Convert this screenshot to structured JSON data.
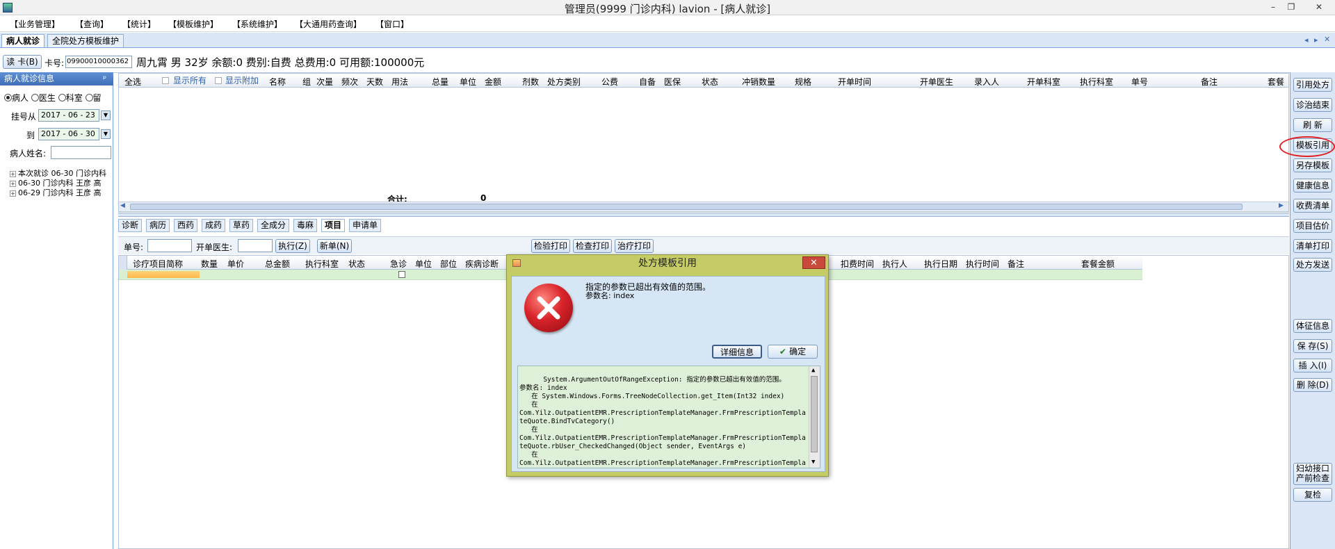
{
  "window": {
    "title": "管理员(9999 门诊内科) lavion - [病人就诊]",
    "controls": [
      "–",
      "❐",
      "✕"
    ]
  },
  "menu": [
    "【业务管理】",
    "【查询】",
    "【统计】",
    "【模板维护】",
    "【系统维护】",
    "【大通用药查询】",
    "【窗口】"
  ],
  "tabs": [
    "病人就诊",
    "全院处方模板维护"
  ],
  "tab_nav": [
    "◂",
    "▸",
    "✕"
  ],
  "patient_bar": {
    "read_card": "读 卡(B)",
    "card_label": "卡号:",
    "card_value": "09900010000362",
    "info": "周九霄  男  32岁  余额:0  费别:自费  总费用:0  可用额:100000元"
  },
  "left_panel": {
    "header": "病人就诊信息",
    "pin": "ᵖ",
    "radios": [
      "病人",
      "医生",
      "科室",
      "留"
    ],
    "date_from_label": "挂号从",
    "date_from": "2017 - 06 - 23",
    "date_to_label": "到",
    "date_to": "2017 - 06 - 30",
    "name_label": "病人姓名:",
    "tree": [
      "本次就诊  06-30  门诊内科",
      "06-30  门诊内科  王彦  高",
      "06-29  门诊内科  王彦  高"
    ]
  },
  "top_grid": {
    "columns": [
      "全选",
      "显示所有",
      "显示附加",
      "名称",
      "组",
      "次量",
      "频次",
      "天数",
      "用法",
      "总量",
      "单位",
      "金额",
      "剂数",
      "处方类别",
      "公费",
      "自备",
      "医保",
      "状态",
      "冲销数量",
      "规格",
      "开单时间",
      "开单医生",
      "录入人",
      "开单科室",
      "执行科室",
      "单号",
      "备注",
      "套餐"
    ],
    "total_label": "合计:",
    "total_value": "0"
  },
  "sub_tabs": [
    "诊断",
    "病历",
    "西药",
    "成药",
    "草药",
    "全成分",
    "毒麻",
    "项目",
    "申请单"
  ],
  "item_toolbar": {
    "order_label": "单号:",
    "doctor_label": "开单医生:",
    "execute": "执行(Z)",
    "new": "新单(N)",
    "lab_print": "检验打印",
    "exam_print": "检查打印",
    "treat_print": "治疗打印"
  },
  "bottom_grid": {
    "columns": [
      "诊疗项目简称",
      "数量",
      "单价",
      "总金额",
      "执行科室",
      "状态",
      "急诊",
      "单位",
      "部位",
      "疾病诊断",
      "扣费时间",
      "执行人",
      "执行日期",
      "执行时间",
      "备注",
      "套餐金额"
    ]
  },
  "right_buttons": [
    "引用处方",
    "诊治结束",
    "刷 新",
    "模板引用",
    "另存模板",
    "健康信息",
    "收费清单",
    "项目估价",
    "清单打印",
    "处方发送",
    "体征信息",
    "保 存(S)",
    "插 入(I)",
    "删 除(D)",
    "妇幼接口\n产前检查",
    "复检"
  ],
  "dialog": {
    "title": "处方模板引用",
    "close": "✕",
    "message": "指定的参数已超出有效值的范围。",
    "param": "参数名: index",
    "details_button": "详细信息",
    "ok_button": "确定",
    "details": "System.ArgumentOutOfRangeException: 指定的参数已超出有效值的范围。\n参数名: index\n   在 System.Windows.Forms.TreeNodeCollection.get_Item(Int32 index)\n   在\nCom.Yilz.OutpatientEMR.PrescriptionTemplateManager.FrmPrescriptionTemplateQuote.BindTvCategory()\n   在\nCom.Yilz.OutpatientEMR.PrescriptionTemplateManager.FrmPrescriptionTemplateQuote.rbUser_CheckedChanged(Object sender, EventArgs e)\n   在\nCom.Yilz.OutpatientEMR.PrescriptionTemplateManager.FrmPrescriptionTemplateQuote.FrmPrescriptionTemplateQuote_Load(Object sender, EventArgs"
  },
  "colors": {
    "accent": "#3e6fb8",
    "dialog_frame": "#c5cc66",
    "error_red": "#d9232a",
    "highlight_circle": "#e02020"
  }
}
